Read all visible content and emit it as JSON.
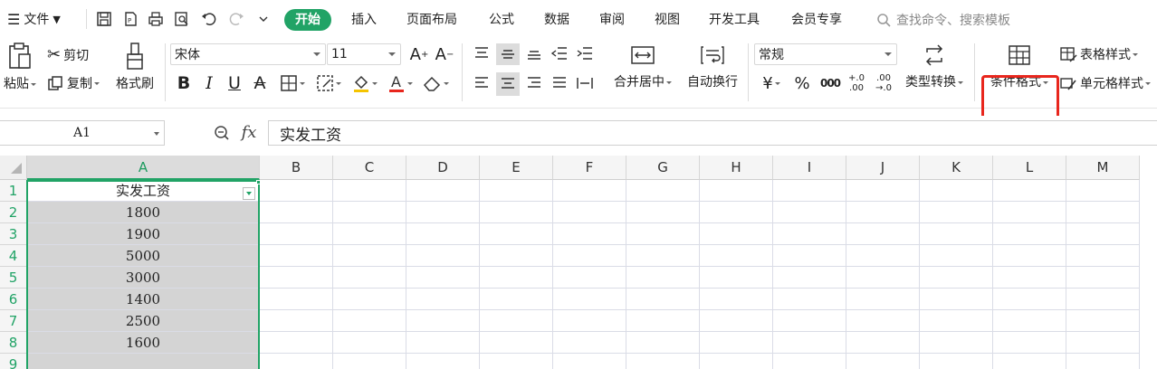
{
  "menubar": {
    "file_label": "文件",
    "tabs": [
      "开始",
      "插入",
      "页面布局",
      "公式",
      "数据",
      "审阅",
      "视图",
      "开发工具",
      "会员专享"
    ],
    "active_tab": "开始",
    "search_placeholder": "查找命令、搜索模板"
  },
  "ribbon": {
    "paste_label": "粘贴",
    "cut_label": "剪切",
    "copy_label": "复制",
    "format_painter_label": "格式刷",
    "font_name": "宋体",
    "font_size": "11",
    "merge_label": "合并居中",
    "wrap_label": "自动换行",
    "number_format": "常规",
    "type_convert_label": "类型转换",
    "conditional_format_label": "条件格式",
    "table_style_label": "表格样式",
    "cell_style_label": "单元格样式",
    "currency_symbol": "¥",
    "percent_symbol": "%",
    "thousands_symbol": "000",
    "inc_decimal": "+.0 .00",
    "dec_decimal": ".00 →.0"
  },
  "formula_bar": {
    "name_box": "A1",
    "fx": "fx",
    "content": "实发工资"
  },
  "sheet": {
    "columns": [
      "A",
      "B",
      "C",
      "D",
      "E",
      "F",
      "G",
      "H",
      "I",
      "J",
      "K",
      "L",
      "M"
    ],
    "rows": [
      "1",
      "2",
      "3",
      "4",
      "5",
      "6",
      "7",
      "8",
      "9"
    ],
    "column_a": [
      "实发工资",
      "1800",
      "1900",
      "5000",
      "3000",
      "1400",
      "2500",
      "1600",
      ""
    ]
  },
  "colors": {
    "accent": "#21a366",
    "highlight_border": "#e8261d",
    "selected_fill": "#d4d4d4"
  }
}
